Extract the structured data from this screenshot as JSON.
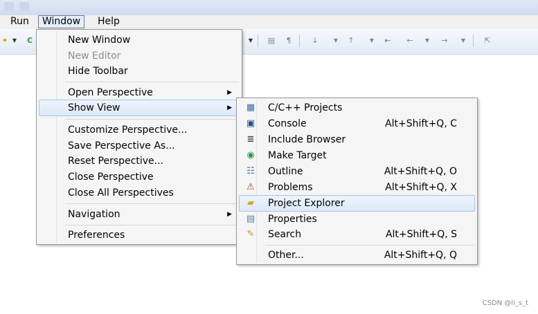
{
  "menubar": {
    "run": "Run",
    "window": "Window",
    "help": "Help"
  },
  "window_menu": {
    "new_window": "New Window",
    "new_editor": "New Editor",
    "hide_toolbar": "Hide Toolbar",
    "open_perspective": "Open Perspective",
    "show_view": "Show View",
    "customize_perspective": "Customize Perspective...",
    "save_perspective_as": "Save Perspective As...",
    "reset_perspective": "Reset Perspective...",
    "close_perspective": "Close Perspective",
    "close_all_perspectives": "Close All Perspectives",
    "navigation": "Navigation",
    "preferences": "Preferences"
  },
  "show_view_menu": {
    "items": [
      {
        "label": "C/C++ Projects",
        "shortcut": "",
        "icon": "cpp-projects-icon"
      },
      {
        "label": "Console",
        "shortcut": "Alt+Shift+Q, C",
        "icon": "console-icon"
      },
      {
        "label": "Include Browser",
        "shortcut": "",
        "icon": "include-browser-icon"
      },
      {
        "label": "Make Target",
        "shortcut": "",
        "icon": "make-target-icon"
      },
      {
        "label": "Outline",
        "shortcut": "Alt+Shift+Q, O",
        "icon": "outline-icon"
      },
      {
        "label": "Problems",
        "shortcut": "Alt+Shift+Q, X",
        "icon": "problems-icon"
      },
      {
        "label": "Project Explorer",
        "shortcut": "",
        "icon": "folder-icon"
      },
      {
        "label": "Properties",
        "shortcut": "",
        "icon": "properties-icon"
      },
      {
        "label": "Search",
        "shortcut": "Alt+Shift+Q, S",
        "icon": "search-icon"
      }
    ],
    "other": {
      "label": "Other...",
      "shortcut": "Alt+Shift+Q, Q"
    }
  },
  "watermark": "CSDN @li_s_t"
}
